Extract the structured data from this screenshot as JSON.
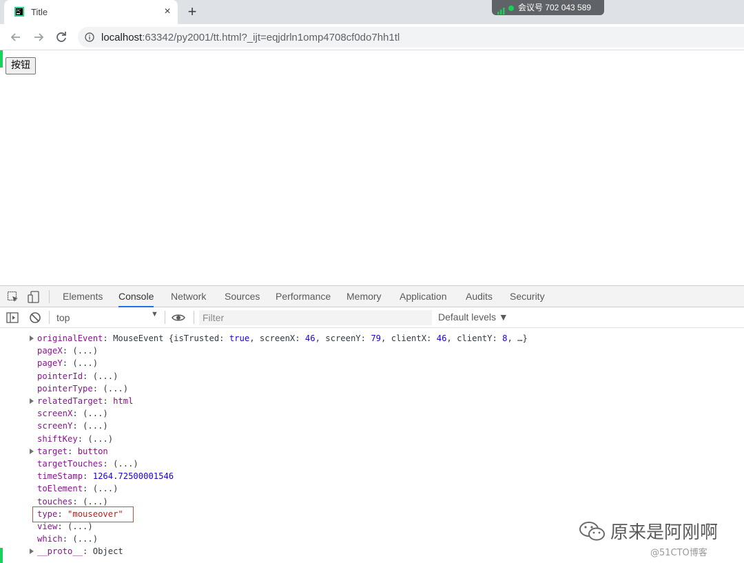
{
  "browser": {
    "tab_title": "Title",
    "tab_close": "×",
    "new_tab": "+",
    "meeting_label": "会议号 702 043 589",
    "url_host": "localhost",
    "url_rest": ":63342/py2001/tt.html?_ijt=eqjdrln1omp4708cf0do7hh1tl"
  },
  "page": {
    "button_label": "按钮"
  },
  "devtools": {
    "tabs": [
      "Elements",
      "Console",
      "Network",
      "Sources",
      "Performance",
      "Memory",
      "Application",
      "Audits",
      "Security"
    ],
    "active_tab": "Console",
    "context": "top",
    "filter_placeholder": "Filter",
    "levels_label": "Default levels ▼",
    "lines": [
      {
        "key": "originalEvent",
        "expand": true,
        "val": "MouseEvent {isTrusted: true, screenX: 46, screenY: 79, clientX: 46, clientY: 8, …}"
      },
      {
        "key": "pageX",
        "expand": false,
        "val": "(...)"
      },
      {
        "key": "pageY",
        "expand": false,
        "val": "(...)"
      },
      {
        "key": "pointerId",
        "expand": false,
        "val": "(...)"
      },
      {
        "key": "pointerType",
        "expand": false,
        "val": "(...)"
      },
      {
        "key": "relatedTarget",
        "expand": true,
        "val": "html"
      },
      {
        "key": "screenX",
        "expand": false,
        "val": "(...)"
      },
      {
        "key": "screenY",
        "expand": false,
        "val": "(...)"
      },
      {
        "key": "shiftKey",
        "expand": false,
        "val": "(...)"
      },
      {
        "key": "target",
        "expand": true,
        "val": "button"
      },
      {
        "key": "targetTouches",
        "expand": false,
        "val": "(...)"
      },
      {
        "key": "timeStamp",
        "expand": false,
        "val": "1264.72500001546"
      },
      {
        "key": "toElement",
        "expand": false,
        "val": "(...)"
      },
      {
        "key": "touches",
        "expand": false,
        "val": "(...)"
      },
      {
        "key": "type",
        "expand": false,
        "val": "\"mouseover\""
      },
      {
        "key": "view",
        "expand": false,
        "val": "(...)"
      },
      {
        "key": "which",
        "expand": false,
        "val": "(...)"
      },
      {
        "key": "__proto__",
        "expand": true,
        "val": "Object"
      }
    ]
  },
  "watermark": {
    "text": "原来是阿刚啊",
    "copyright": "@51CTO博客"
  },
  "colors": {
    "accent_green": "#19d15a",
    "devtools_active": "#1a73e8",
    "highlight_box": "#e0443e"
  }
}
